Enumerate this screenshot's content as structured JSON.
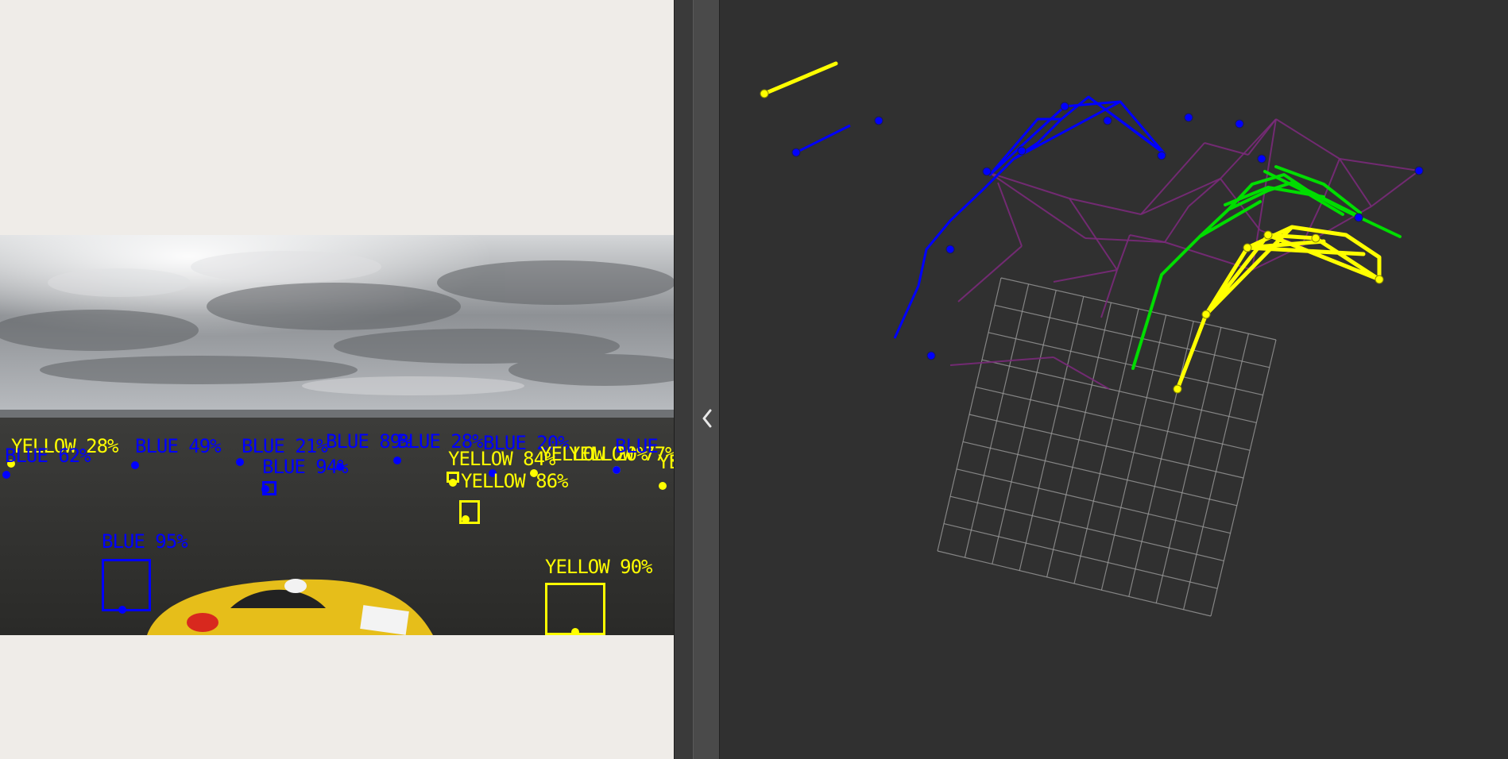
{
  "detections": [
    {
      "label": "YELLOW 28%",
      "color": "#ffff00",
      "box": false
    },
    {
      "label": "BLUE 62%",
      "color": "#0000ff",
      "box": false
    },
    {
      "label": "BLUE 49%",
      "color": "#0000ff",
      "box": false
    },
    {
      "label": "BLUE 21%",
      "color": "#0000ff",
      "box": false
    },
    {
      "label": "BLUE 94%",
      "color": "#0000ff",
      "box": true
    },
    {
      "label": "BLUE 89%",
      "color": "#0000ff",
      "box": false
    },
    {
      "label": "BLUE 28%",
      "color": "#0000ff",
      "box": false
    },
    {
      "label": "BLUE 20%",
      "color": "#0000ff",
      "box": false
    },
    {
      "label": "YELLOW 84%",
      "color": "#ffff00",
      "box": true
    },
    {
      "label": "YELLOW 20%",
      "color": "#ffff00",
      "box": false
    },
    {
      "label": "YELLOW 77%",
      "color": "#ffff00",
      "box": false
    },
    {
      "label": "YELLOW 86%",
      "color": "#ffff00",
      "box": true
    },
    {
      "label": "BLUE",
      "color": "#0000ff",
      "box": false
    },
    {
      "label": "YE",
      "color": "#ffff00",
      "box": false
    },
    {
      "label": "BLUE 95%",
      "color": "#0000ff",
      "box": true
    },
    {
      "label": "YELLOW 90%",
      "color": "#ffff00",
      "box": true
    }
  ],
  "colors": {
    "blue_cone": "#0000ff",
    "yellow_cone": "#ffff00",
    "planned_path": "#00dd00",
    "track_mesh": "#7a2a7a",
    "grid": "#9a9a9a",
    "viewer_bg": "#303030"
  },
  "icons": {
    "collapse": "chevron-left-icon"
  }
}
